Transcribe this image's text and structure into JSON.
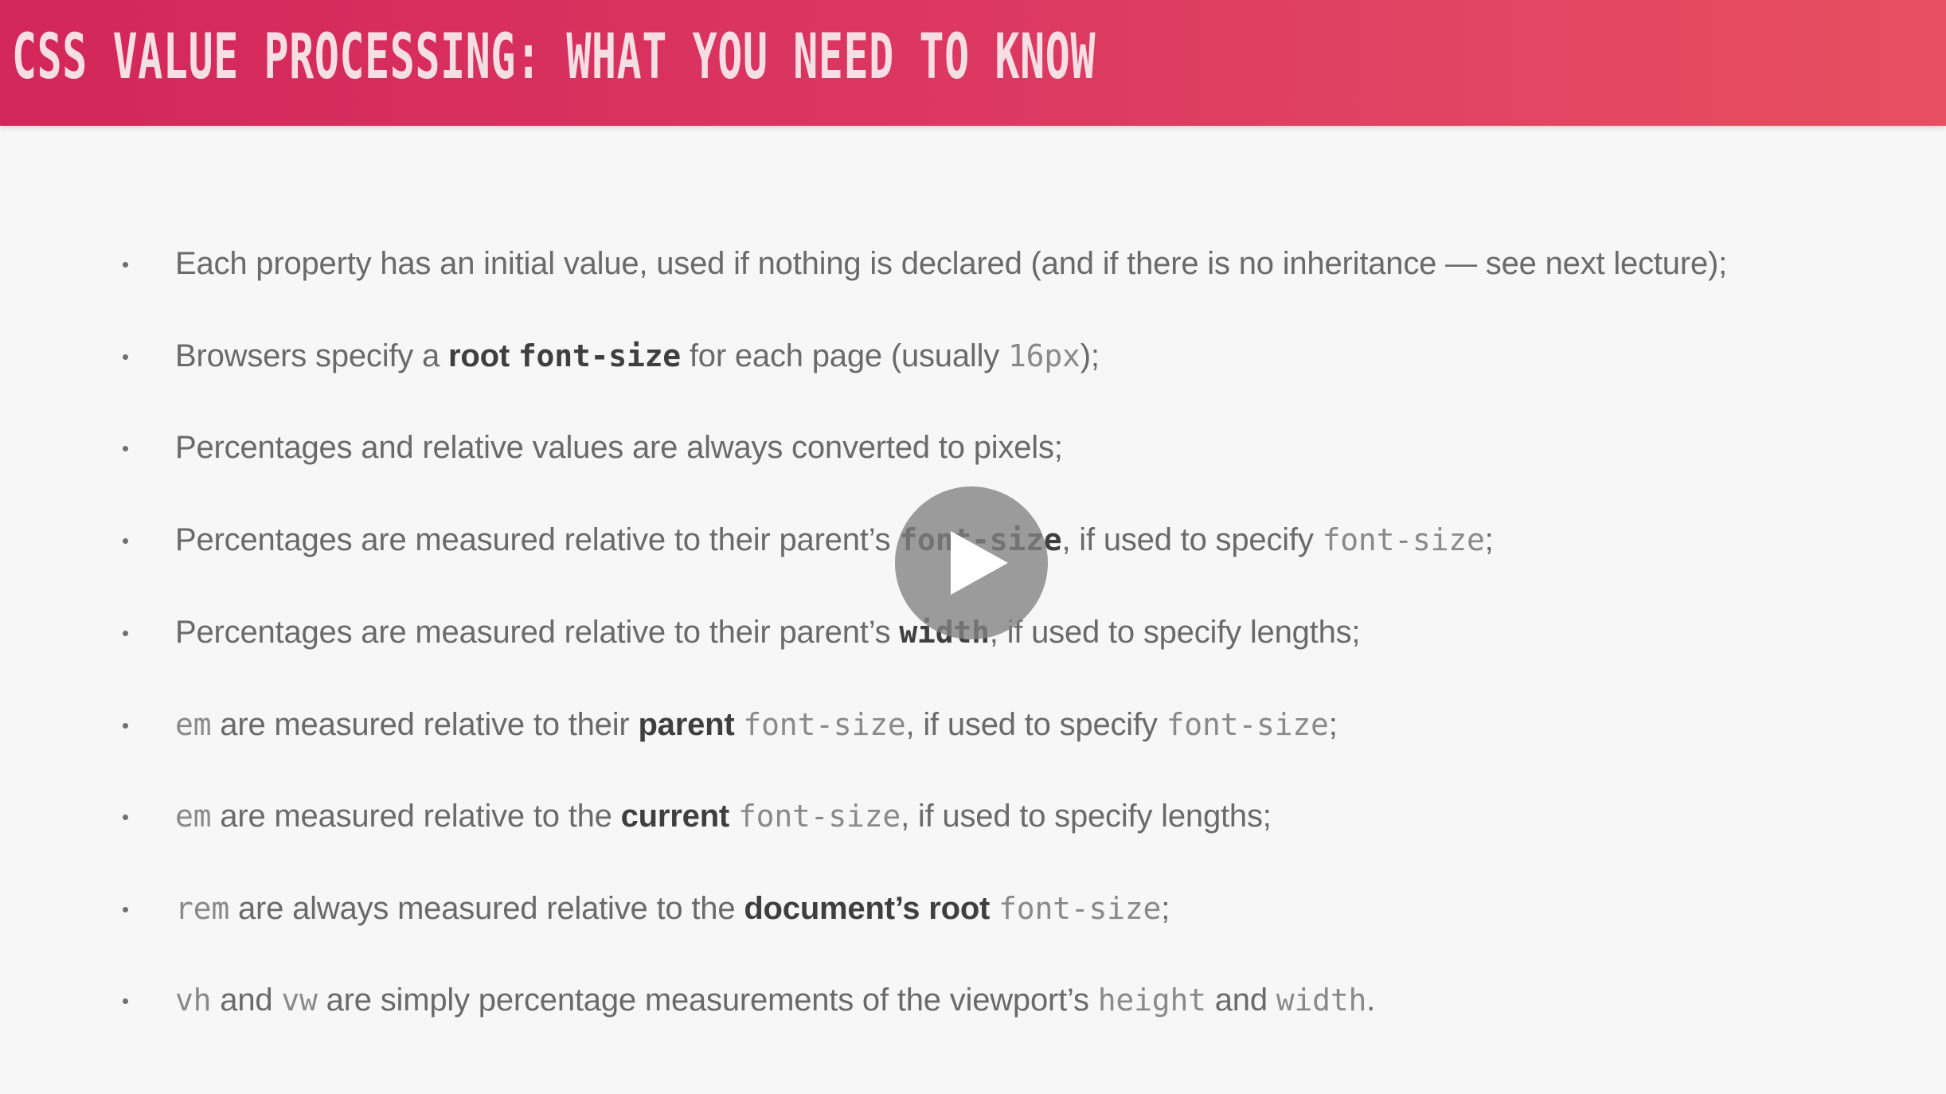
{
  "header": {
    "title": "CSS VALUE PROCESSING: WHAT YOU NEED TO KNOW"
  },
  "bullets": [
    {
      "a": "Each property has an initial value, used if nothing is declared (and if there is no inheritance — see next lecture);"
    },
    {
      "a": "Browsers specify a ",
      "b": "root",
      "c": "font-size",
      "d": " for each page (usually ",
      "e": "16px",
      "f": ");"
    },
    {
      "a": "Percentages and relative values are always converted to pixels;"
    },
    {
      "a": "Percentages are measured relative to their parent’s ",
      "b": "font-size",
      "c": ", if used to specify ",
      "d": "font-size",
      "e": ";"
    },
    {
      "a": "Percentages are measured relative to their parent’s ",
      "b": "width",
      "c": ", if used to specify lengths;"
    },
    {
      "a": "em",
      "b": " are measured relative to their ",
      "c": "parent",
      "d": "font-size",
      "e": ", if used to specify ",
      "f": "font-size",
      "g": ";"
    },
    {
      "a": "em",
      "b": " are measured relative to the ",
      "c": "current",
      "d": "font-size",
      "e": ", if used to specify lengths;"
    },
    {
      "a": "rem",
      "b": " are always measured relative to the ",
      "c": "document’s root",
      "d": "font-size",
      "e": ";"
    },
    {
      "a": "vh",
      "b": " and ",
      "c": "vw",
      "d": " are simply percentage measurements of the viewport’s ",
      "e": "height",
      "f": " and ",
      "g": "width",
      "h": "."
    }
  ],
  "player": {
    "play_icon": "play-icon",
    "overlay_color": "#828282"
  },
  "colors": {
    "header_start": "#d3265a",
    "header_end": "#e84f61",
    "title_text": "#f6dfe4",
    "body_text": "#6a6a6a",
    "bold_text": "#3f3f3f",
    "background": "#f7f7f7"
  }
}
